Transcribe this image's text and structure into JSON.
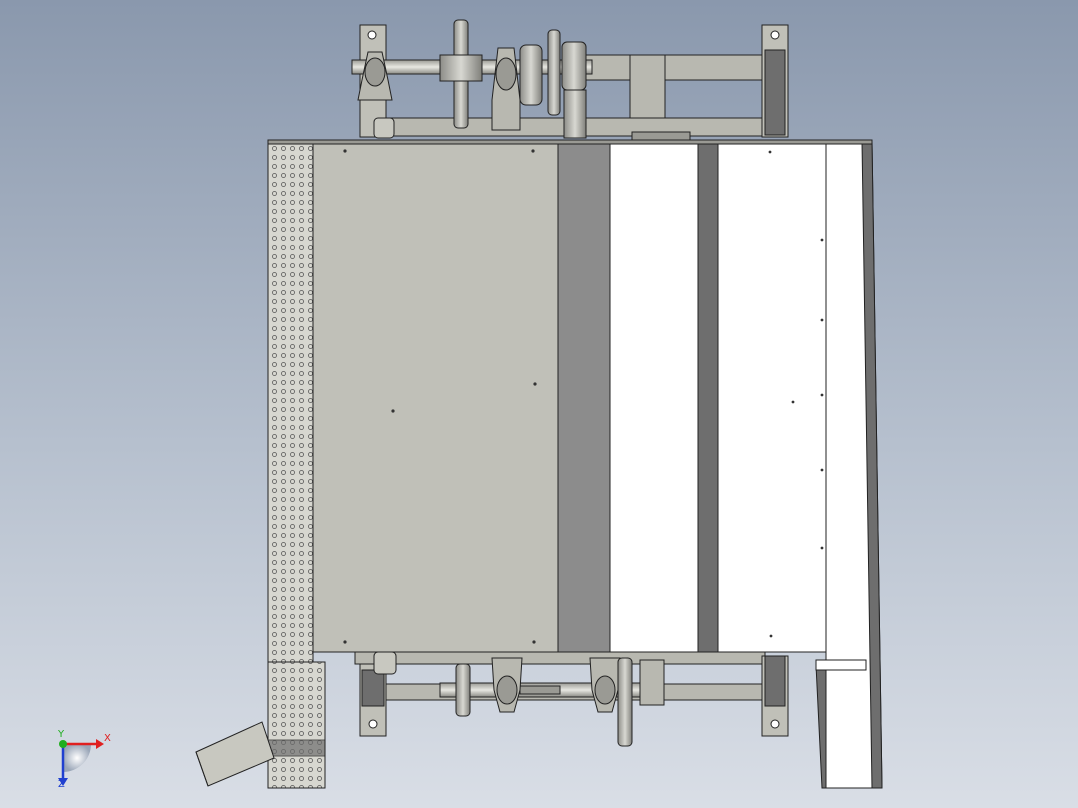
{
  "viewport": {
    "background_top": "#8a98ad",
    "background_bottom": "#d9dee6"
  },
  "triad": {
    "x_label": "X",
    "y_label": "Y",
    "z_label": "Z",
    "x_color": "#e02020",
    "y_color": "#1fae1f",
    "z_color": "#2040d0"
  },
  "colors": {
    "panel_gray": "#c0c0b8",
    "dark_band": "#8c8c8c",
    "white_panel": "#ffffff",
    "frame_gray": "#b8b8b0",
    "dark_steel": "#6e6e6e",
    "outline": "#222222"
  }
}
